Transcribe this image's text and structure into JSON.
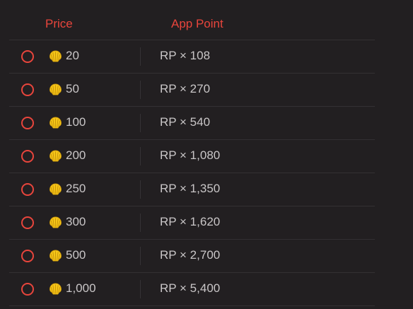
{
  "colors": {
    "background": "#221f21",
    "accent": "#e8453c",
    "text": "#c9c6c7",
    "divider": "#333033",
    "coin": "#f5c518"
  },
  "header": {
    "price_label": "Price",
    "points_label": "App Point"
  },
  "rows": [
    {
      "price": "20",
      "points": "RP × 108",
      "icon": "shell-coin-icon",
      "selected": false
    },
    {
      "price": "50",
      "points": "RP × 270",
      "icon": "shell-coin-icon",
      "selected": false
    },
    {
      "price": "100",
      "points": "RP × 540",
      "icon": "shell-coin-icon",
      "selected": false
    },
    {
      "price": "200",
      "points": "RP × 1,080",
      "icon": "shell-coin-icon",
      "selected": false
    },
    {
      "price": "250",
      "points": "RP × 1,350",
      "icon": "shell-coin-icon",
      "selected": false
    },
    {
      "price": "300",
      "points": "RP × 1,620",
      "icon": "shell-coin-icon",
      "selected": false
    },
    {
      "price": "500",
      "points": "RP × 2,700",
      "icon": "shell-coin-icon",
      "selected": false
    },
    {
      "price": "1,000",
      "points": "RP × 5,400",
      "icon": "shell-coin-icon",
      "selected": false
    }
  ]
}
